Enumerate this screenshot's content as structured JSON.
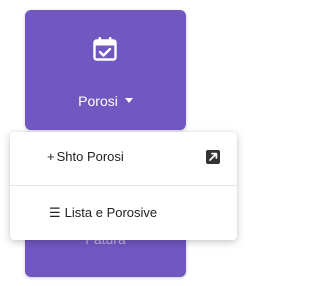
{
  "colors": {
    "tile_background": "#7058c0",
    "tile_text": "#ffffff",
    "menu_background": "#ffffff",
    "menu_text": "#222222"
  },
  "tile_top": {
    "label": "Porosi",
    "icon": "calendar-check-icon",
    "caret_icon": "caret-down-icon"
  },
  "tile_bottom": {
    "label": "Fatura"
  },
  "dropdown": {
    "items": [
      {
        "prefix": "+",
        "label": "Shto Porosi",
        "trailing_icon": "external-link-icon"
      },
      {
        "prefix": "☰",
        "label": "Lista e Porosive"
      }
    ]
  }
}
